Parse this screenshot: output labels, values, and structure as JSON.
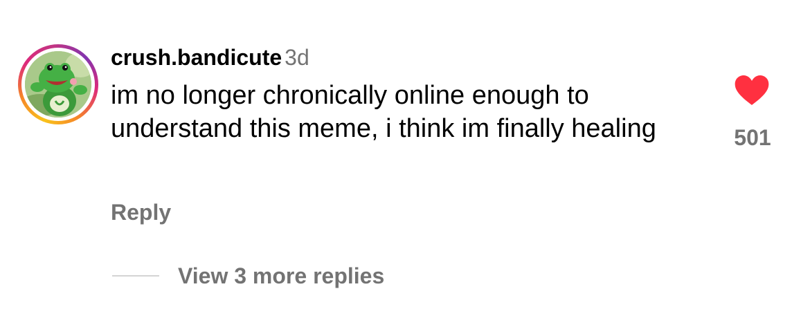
{
  "comment": {
    "username": "crush.bandicute",
    "timestamp": "3d",
    "text": "im no longer chronically online enough to understand this meme, i think im finally healing",
    "reply_label": "Reply",
    "like_count": "501",
    "liked": true,
    "view_replies_label": "View 3 more replies"
  },
  "icons": {
    "like": "heart-icon",
    "avatar_ring": "story-ring"
  },
  "colors": {
    "heart": "#ff3040",
    "secondary_text": "#737373",
    "primary_text": "#000000"
  }
}
